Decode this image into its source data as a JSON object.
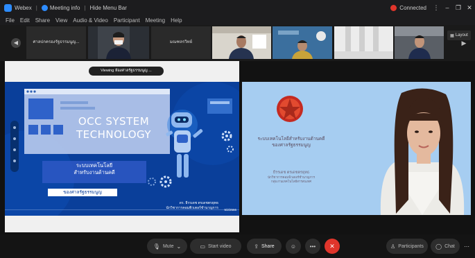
{
  "titlebar": {
    "app": "Webex",
    "meeting_info": "Meeting info",
    "hide_menu": "Hide Menu Bar",
    "status": "Connected",
    "more": "⋮",
    "minimize": "–",
    "maximize": "❐",
    "close": "✕"
  },
  "menu": [
    "File",
    "Edit",
    "Share",
    "View",
    "Audio & Video",
    "Participant",
    "Meeting",
    "Help"
  ],
  "participants_strip": {
    "tiles": [
      {
        "name": "ศาลปกครองรัฐธรรมนูญ..."
      },
      {
        "name": ""
      },
      {
        "name": "มณฑลรวิทย์"
      },
      {
        "name": ""
      },
      {
        "name": ""
      },
      {
        "name": ""
      },
      {
        "name": ""
      }
    ],
    "layout_label": "Layout"
  },
  "share": {
    "viewing_label": "Viewing ห้องศาลรัฐธรรมนูญ ...",
    "slide": {
      "title_line1": "OCC SYSTEM",
      "title_line2": "TECHNOLOGY",
      "thai_box_line1": "ระบบเทคโนโลยี",
      "thai_box_line2": "สำหรับงานด้านคดี",
      "org_label": "ของศาลรัฐธรรมนูญ",
      "presenter_line1": "ดร. ธีรรเดช ตรเดชตรยุทธ",
      "presenter_line2": "นักวิชาการคอมพิวเตอร์ชำนาญการ",
      "date": "5/2/2566"
    }
  },
  "speaker": {
    "line1": "ระบบเทคโนโลยีสำหรับงานด้านคดี",
    "line2": "ของศาลรัฐธรรมนูญ",
    "name": "ธีรรเดช ตรเดชตรยุทธ",
    "role1": "นักวิชาการคอมพิวเตอร์ชำนาญการ",
    "role2": "กลุ่มงานเทคโนโลยีสารสนเทศ"
  },
  "toolbar": {
    "mute": "Mute",
    "start_video": "Start video",
    "share": "Share",
    "participants": "Participants",
    "chat": "Chat",
    "end": "✕"
  },
  "colors": {
    "accent": "#2d8cff",
    "end": "#e0352b",
    "slide_bg": "#0a3f9a",
    "speaker_bg": "#a6cdf1"
  }
}
